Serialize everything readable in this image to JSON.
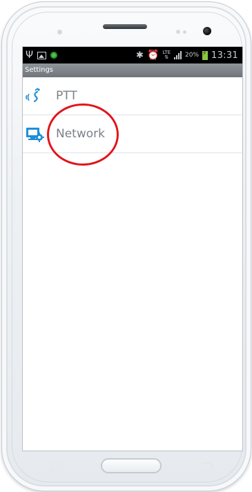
{
  "status_bar": {
    "battery_percent": "20%",
    "network_type": "LTE",
    "time": "13:31"
  },
  "title_bar": {
    "title": "Settings"
  },
  "settings_list": {
    "items": [
      {
        "label": "PTT",
        "icon": "ptt-voice-icon"
      },
      {
        "label": "Network",
        "icon": "network-settings-icon"
      }
    ]
  },
  "colors": {
    "accent": "#1f8fd6",
    "annotation": "#e2141b",
    "title_bar": "#7f858a"
  }
}
